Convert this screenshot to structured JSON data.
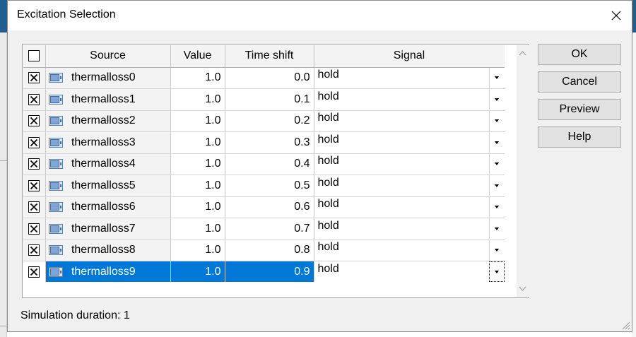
{
  "dialog": {
    "title": "Excitation Selection"
  },
  "table": {
    "columns": [
      "Source",
      "Value",
      "Time shift",
      "Signal"
    ],
    "rows": [
      {
        "checked": true,
        "source": "thermalloss0",
        "value": "1.0",
        "time_shift": "0.0",
        "signal": "hold"
      },
      {
        "checked": true,
        "source": "thermalloss1",
        "value": "1.0",
        "time_shift": "0.1",
        "signal": "hold"
      },
      {
        "checked": true,
        "source": "thermalloss2",
        "value": "1.0",
        "time_shift": "0.2",
        "signal": "hold"
      },
      {
        "checked": true,
        "source": "thermalloss3",
        "value": "1.0",
        "time_shift": "0.3",
        "signal": "hold"
      },
      {
        "checked": true,
        "source": "thermalloss4",
        "value": "1.0",
        "time_shift": "0.4",
        "signal": "hold"
      },
      {
        "checked": true,
        "source": "thermalloss5",
        "value": "1.0",
        "time_shift": "0.5",
        "signal": "hold"
      },
      {
        "checked": true,
        "source": "thermalloss6",
        "value": "1.0",
        "time_shift": "0.6",
        "signal": "hold"
      },
      {
        "checked": true,
        "source": "thermalloss7",
        "value": "1.0",
        "time_shift": "0.7",
        "signal": "hold"
      },
      {
        "checked": true,
        "source": "thermalloss8",
        "value": "1.0",
        "time_shift": "0.8",
        "signal": "hold"
      },
      {
        "checked": true,
        "source": "thermalloss9",
        "value": "1.0",
        "time_shift": "0.9",
        "signal": "hold",
        "selected": true
      }
    ]
  },
  "buttons": {
    "ok": "OK",
    "cancel": "Cancel",
    "preview": "Preview",
    "help": "Help"
  },
  "footer": {
    "duration_text": "Simulation duration: 1"
  },
  "colors": {
    "selection": "#0078d7",
    "dialog_bg": "#f0f0f0",
    "button_bg": "#e1e1e1"
  },
  "icons": {
    "source_row": "source-node-icon",
    "checked": "x-mark-icon",
    "dropdown": "chevron-down-icon"
  }
}
